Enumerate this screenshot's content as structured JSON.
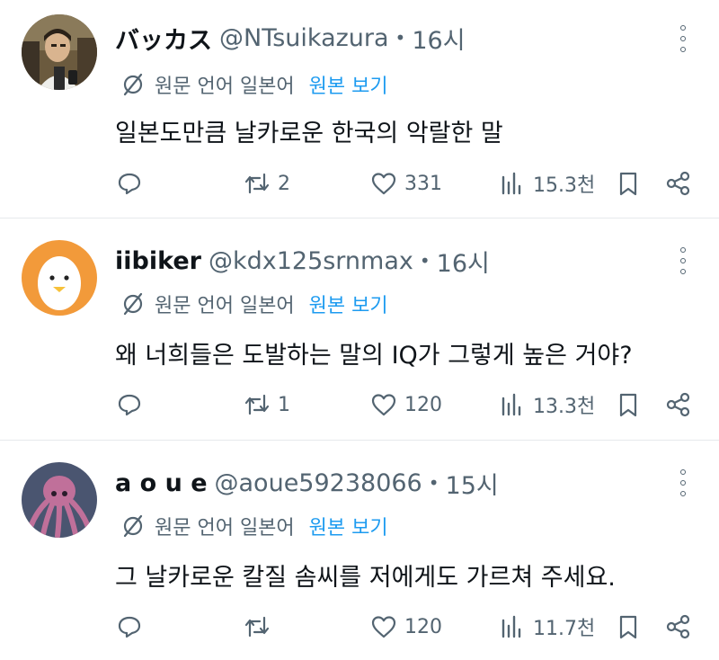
{
  "translate": {
    "label": "원문 언어 일본어",
    "link": "원본 보기"
  },
  "posts": [
    {
      "display_name": "バッカス",
      "handle": "@NTsuikazura",
      "separator": "•",
      "time": "16시",
      "text": "일본도만큼 날카로운 한국의 악랄한 말",
      "replies": "",
      "reposts": "2",
      "likes": "331",
      "views": "15.3천",
      "avatar": "photo-man-icon"
    },
    {
      "display_name": "iibiker",
      "handle": "@kdx125srnmax",
      "separator": "•",
      "time": "16시",
      "text": "왜 너희들은 도발하는 말의 IQ가 그렇게 높은 거야?",
      "replies": "",
      "reposts": "1",
      "likes": "120",
      "views": "13.3천",
      "avatar": "egg-character-icon"
    },
    {
      "display_name": "a o u e",
      "handle": "@aoue59238066",
      "separator": "•",
      "time": "15시",
      "text": "그 날카로운 칼질 솜씨를 저에게도 가르쳐 주세요.",
      "replies": "",
      "reposts": "",
      "likes": "120",
      "views": "11.7천",
      "avatar": "octopus-icon"
    }
  ],
  "colors": {
    "text": "#0f1419",
    "secondary": "#536471",
    "link": "#1d9bf0",
    "divider": "#e6e9ec",
    "egg_bg": "#f29a3a",
    "octopus": "#c0709a"
  }
}
